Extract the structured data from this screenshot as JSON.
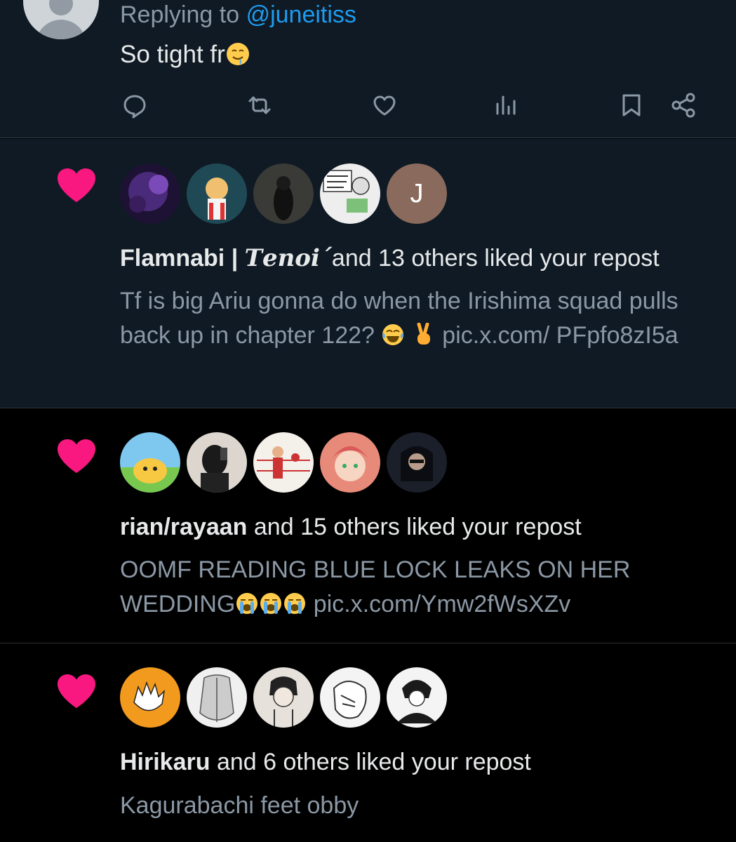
{
  "reply": {
    "replying_prefix": "Replying to",
    "replying_handle": "@juneitiss",
    "text": "So tight fr",
    "text_emoji": "drooling-face-icon"
  },
  "actions": {
    "icons": [
      "reply-icon",
      "repost-icon",
      "like-icon",
      "views-icon",
      "bookmark-icon",
      "share-icon"
    ]
  },
  "notifications": [
    {
      "name": "Flamnabi | ",
      "name_styled": "𝑻𝒆𝒏𝒐𝒊´",
      "rest": "and 13 others liked your repost",
      "excerpt_text": "Tf is big Ariu gonna do when the Irishima squad pulls back up in chapter 122?",
      "excerpt_link": "pic.x.com/ PFpfo8zI5a",
      "avatar_letter": "J"
    },
    {
      "name": "rian/rayaan",
      "rest": " and 15 others liked your repost",
      "excerpt_text": "OOMF READING BLUE LOCK LEAKS ON HER WEDDING",
      "excerpt_link": "pic.x.com/Ymw2fWsXZv"
    },
    {
      "name": "Hirikaru",
      "rest": " and 6 others liked your repost",
      "excerpt_text": "Kagurabachi feet obby"
    }
  ],
  "colors": {
    "heart": "#f91880",
    "link": "#1d9bf0",
    "muted": "#8b98a5",
    "dim_bg": "#0f1a24"
  }
}
